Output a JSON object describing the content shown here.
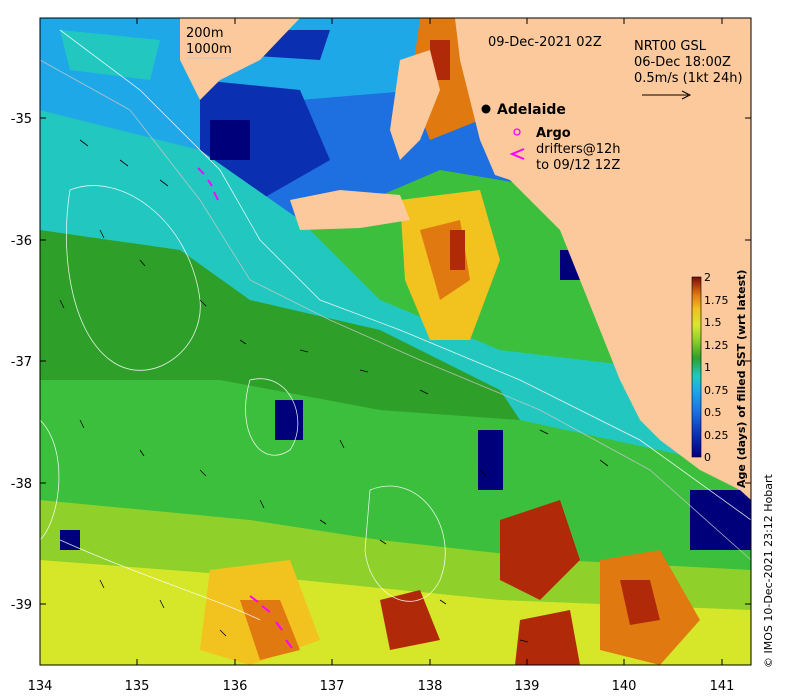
{
  "map": {
    "date_title": "09-Dec-2021 02Z",
    "contour_legend": {
      "line1": "200m",
      "line2": "1000m"
    },
    "current_source": {
      "line1": "NRT00 GSL",
      "line2": "06-Dec 18:00Z",
      "line3": "0.5m/s (1kt 24h)"
    },
    "city": "Adelaide",
    "argo_label": "Argo",
    "drifters_label": {
      "line1": "drifters@12h",
      "line2": "to 09/12 12Z"
    },
    "x_ticks": [
      "134",
      "135",
      "136",
      "137",
      "138",
      "139",
      "140",
      "141"
    ],
    "y_ticks": [
      "-35",
      "-36",
      "-37",
      "-38",
      "-39"
    ],
    "colorbar": {
      "title": "Age (days) of filled SST (wrt latest)",
      "ticks": [
        "0",
        "0.25",
        "0.5",
        "0.75",
        "1",
        "1.25",
        "1.5",
        "1.75",
        "2"
      ]
    },
    "copyright": "© IMOS 10-Dec-2021 23:12 Hobart",
    "colors": {
      "land": "#fcc99c",
      "scale": [
        "#00007a",
        "#0a2fb0",
        "#1e6fe0",
        "#1ea8e8",
        "#22c8c0",
        "#3cbf3c",
        "#2ea02a",
        "#8fd12a",
        "#d6e72a",
        "#f2c21e",
        "#e07a10",
        "#b02a0a",
        "#7a0a0a"
      ],
      "drifters": "#ff00ff"
    }
  }
}
